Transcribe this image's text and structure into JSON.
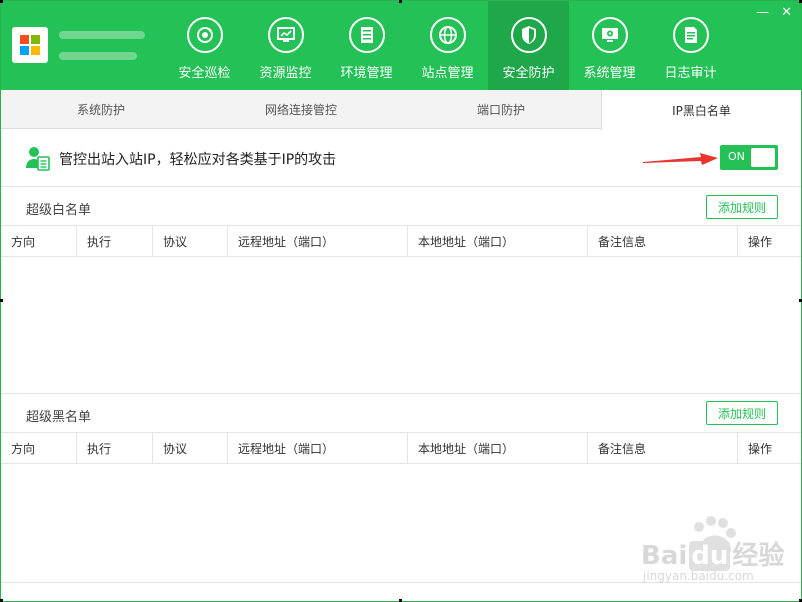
{
  "colors": {
    "accent": "#24c256",
    "accent_dark": "#1ea84a",
    "arrow": "#e8352f"
  },
  "nav": [
    {
      "label": "安全巡检",
      "icon": "refresh-shield-icon"
    },
    {
      "label": "资源监控",
      "icon": "monitor-chart-icon"
    },
    {
      "label": "环境管理",
      "icon": "server-icon"
    },
    {
      "label": "站点管理",
      "icon": "globe-icon"
    },
    {
      "label": "安全防护",
      "icon": "shield-icon",
      "active": true
    },
    {
      "label": "系统管理",
      "icon": "display-gear-icon"
    },
    {
      "label": "日志审计",
      "icon": "document-icon"
    }
  ],
  "window_buttons": {
    "minimize": "—",
    "close": "✕"
  },
  "tabs": [
    {
      "label": "系统防护"
    },
    {
      "label": "网络连接管控"
    },
    {
      "label": "端口防护"
    },
    {
      "label": "IP黑白名单",
      "active": true
    }
  ],
  "banner": {
    "text": "管控出站入站IP，轻松应对各类基于IP的攻击",
    "toggle": "ON"
  },
  "whitelist": {
    "title": "超级白名单",
    "add_label": "添加规则"
  },
  "blacklist": {
    "title": "超级黑名单",
    "add_label": "添加规则"
  },
  "columns": [
    "方向",
    "执行",
    "协议",
    "远程地址（端口）",
    "本地地址（端口）",
    "备注信息",
    "操作"
  ],
  "watermark": {
    "line1": "Bai",
    "line2": "du",
    "line3": "经验",
    "url": "jingyan.baidu.com"
  }
}
